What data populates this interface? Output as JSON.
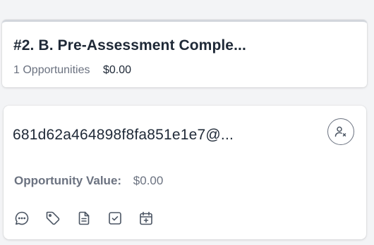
{
  "stage": {
    "title": "#2. B. Pre-Assessment Comple...",
    "count": "1 Opportunities",
    "total": "$0.00"
  },
  "opportunity": {
    "name": "681d62a464898f8fa851e1e7@...",
    "value_label": "Opportunity Value:",
    "value_amount": "$0.00",
    "assign_icon": "user-x-icon",
    "actions": [
      "chat-icon",
      "tag-icon",
      "document-icon",
      "task-checkbox-icon",
      "calendar-add-icon"
    ]
  },
  "colors": {
    "text_dark": "#1f2937",
    "text_muted": "#6b7280",
    "icon": "#4b5563",
    "background": "#f3f4f6",
    "card": "#ffffff"
  }
}
